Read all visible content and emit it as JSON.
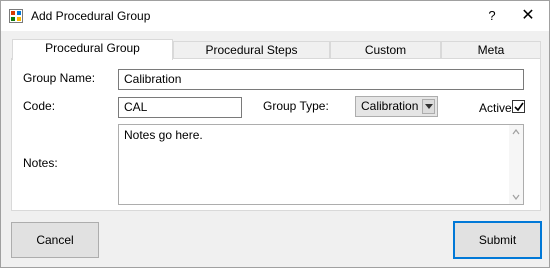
{
  "window": {
    "title": "Add Procedural Group",
    "help_glyph": "?",
    "close_glyph": "✕"
  },
  "tabs": [
    {
      "label": "Procedural Group",
      "active": true
    },
    {
      "label": "Procedural Steps",
      "active": false
    },
    {
      "label": "Custom",
      "active": false
    },
    {
      "label": "Meta",
      "active": false
    }
  ],
  "form": {
    "group_name_label": "Group Name:",
    "group_name_value": "Calibration",
    "code_label": "Code:",
    "code_value": "CAL",
    "group_type_label": "Group Type:",
    "group_type_value": "Calibration",
    "active_label": "Active",
    "active_checked": true,
    "notes_label": "Notes:",
    "notes_value": "Notes go here."
  },
  "buttons": {
    "cancel_label": "Cancel",
    "submit_label": "Submit"
  },
  "colors": {
    "accent": "#0078d7",
    "window_bg": "#f0f0f0",
    "panel_bg": "#ffffff"
  }
}
